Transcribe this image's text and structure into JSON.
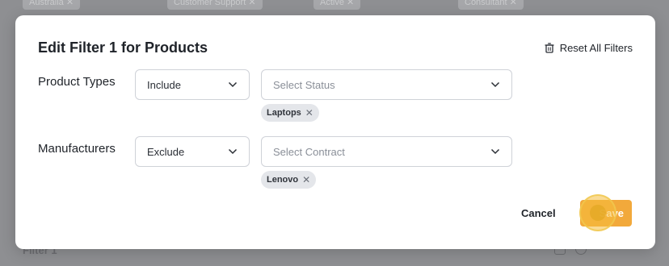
{
  "background": {
    "chips": [
      "Australia",
      "Customer Support",
      "Active",
      "Consultant"
    ],
    "footer_label": "Filter 1"
  },
  "modal": {
    "title": "Edit Filter 1 for Products",
    "reset_label": "Reset All Filters",
    "rows": [
      {
        "label": "Product Types",
        "mode": "Include",
        "select_placeholder": "Select Status",
        "chips": [
          "Laptops"
        ]
      },
      {
        "label": "Manufacturers",
        "mode": "Exclude",
        "select_placeholder": "Select Contract",
        "chips": [
          "Lenovo"
        ]
      }
    ],
    "cancel_label": "Cancel",
    "save_label": "Save"
  },
  "colors": {
    "accent": "#f2a93b",
    "overlay": "#8e8f92"
  }
}
